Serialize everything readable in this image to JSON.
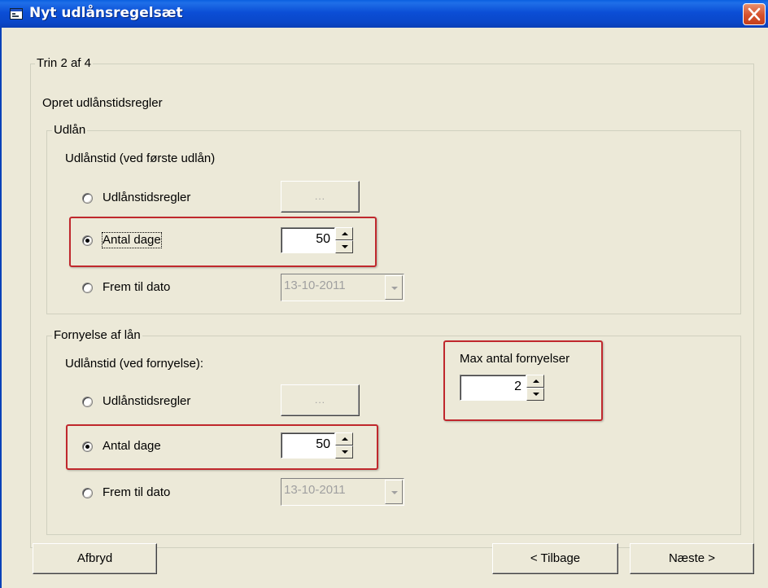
{
  "window": {
    "title": "Nyt udlånsregelsæt"
  },
  "wizard": {
    "step": "Trin 2 af 4",
    "subtitle": "Opret udlånstidsregler",
    "loan": {
      "legend": "Udlån",
      "caption": "Udlånstid (ved første udlån)",
      "option_rules": "Udlånstidsregler",
      "option_days": "Antal dage",
      "option_date": "Frem til dato",
      "rules_button": "...",
      "days_value": "50",
      "date_value": "13-10-2011",
      "selected": "Antal dage"
    },
    "renewal": {
      "legend": "Fornyelse af lån",
      "caption": "Udlånstid (ved fornyelse):",
      "option_rules": "Udlånstidsregler",
      "option_days": "Antal dage",
      "option_date": "Frem til dato",
      "rules_button": "...",
      "days_value": "50",
      "date_value": "13-10-2011",
      "selected": "Antal dage",
      "max_label": "Max antal fornyelser",
      "max_value": "2"
    }
  },
  "buttons": {
    "cancel": "Afbryd",
    "back": "< Tilbage",
    "next": "Næste >"
  },
  "colors": {
    "titlebar": "#0a4fd6",
    "background": "#ece9d8",
    "highlight": "#c0282d",
    "close": "#d5502c"
  },
  "icons": {
    "app": "window-app-icon",
    "close": "close-x-icon",
    "spin_up": "arrow-up-icon",
    "spin_down": "arrow-down-icon",
    "dropdown": "chevron-down-icon"
  }
}
